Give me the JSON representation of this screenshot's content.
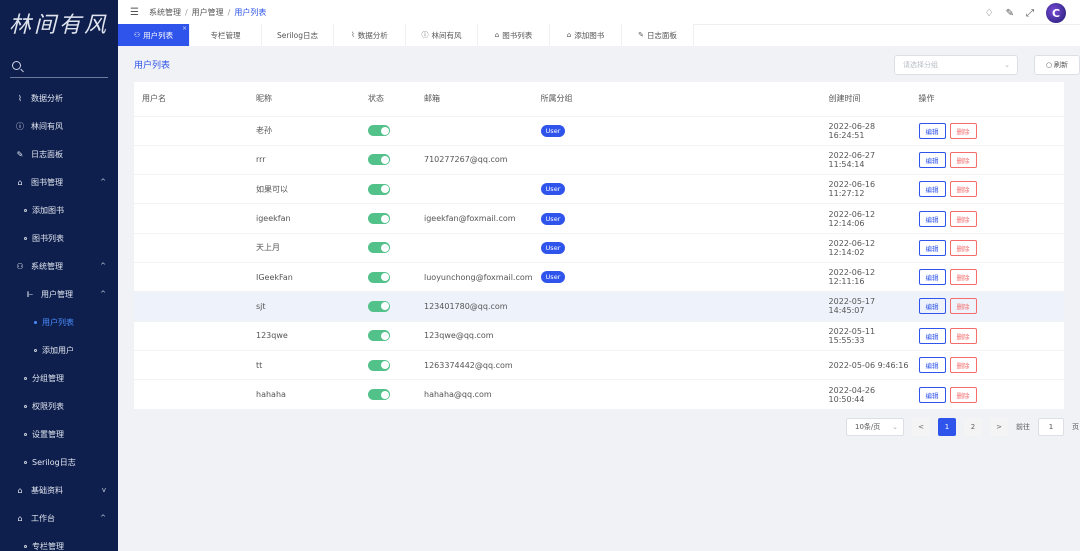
{
  "sidebar": {
    "logo": "林间有风",
    "items": [
      {
        "icon": "chart-icon",
        "glyph": "⌇",
        "label": "数据分析"
      },
      {
        "icon": "info-icon",
        "glyph": "ⓘ",
        "label": "林间有风"
      },
      {
        "icon": "edit-icon",
        "glyph": "✎",
        "label": "日志面板"
      },
      {
        "icon": "book-icon",
        "glyph": "⌂",
        "label": "图书管理",
        "arrow": "^"
      },
      {
        "label": "添加图书"
      },
      {
        "label": "图书列表"
      },
      {
        "icon": "users-icon",
        "glyph": "⚇",
        "label": "系统管理",
        "arrow": "^"
      },
      {
        "icon": "user-manage-icon",
        "glyph": "⊩",
        "label": "用户管理",
        "arrow": "^"
      },
      {
        "label": "用户列表"
      },
      {
        "label": "添加用户"
      },
      {
        "label": "分组管理"
      },
      {
        "label": "权限列表"
      },
      {
        "label": "设置管理"
      },
      {
        "label": "Serilog日志"
      },
      {
        "icon": "book-icon",
        "glyph": "⌂",
        "label": "基础资料",
        "arrow": "v"
      },
      {
        "icon": "book-icon",
        "glyph": "⌂",
        "label": "工作台",
        "arrow": "^"
      },
      {
        "label": "专栏管理"
      }
    ]
  },
  "topbar": {
    "menu_icon": "☰",
    "crumb1": "系统管理",
    "crumb2": "用户管理",
    "crumb3": "用户列表",
    "sep": "/",
    "bell": "♢",
    "magic": "✎",
    "fullscreen": "⤢",
    "avatar_letter": "C"
  },
  "tabs": [
    {
      "icon": "⚇",
      "label": "用户列表",
      "close": "×"
    },
    {
      "icon": "",
      "label": "专栏管理"
    },
    {
      "icon": "",
      "label": "Serilog日志"
    },
    {
      "icon": "⌇",
      "label": "数据分析"
    },
    {
      "icon": "ⓘ",
      "label": "林间有风"
    },
    {
      "icon": "⌂",
      "label": "图书列表"
    },
    {
      "icon": "⌂",
      "label": "添加图书"
    },
    {
      "icon": "✎",
      "label": "日志面板"
    }
  ],
  "panel": {
    "title": "用户列表",
    "group_placeholder": "请选择分组",
    "refresh_label": "刷新"
  },
  "table": {
    "headers": [
      "用户名",
      "昵称",
      "状态",
      "邮箱",
      "所属分组",
      "创建时间",
      "操作"
    ],
    "edit_label": "编辑",
    "delete_label": "删除",
    "rows": [
      {
        "username": "",
        "nickname": "老孙",
        "email": "",
        "group": "User",
        "created": "2022-06-28 16:24:51"
      },
      {
        "username": "",
        "nickname": "rrr",
        "email": "710277267@qq.com",
        "group": "",
        "created": "2022-06-27 11:54:14"
      },
      {
        "username": "",
        "nickname": "如果可以",
        "email": "",
        "group": "User",
        "created": "2022-06-16 11:27:12"
      },
      {
        "username": "",
        "nickname": "igeekfan",
        "email": "igeekfan@foxmail.com",
        "group": "User",
        "created": "2022-06-12 12:14:06"
      },
      {
        "username": "",
        "nickname": "天上月",
        "email": "",
        "group": "User",
        "created": "2022-06-12 12:14:02"
      },
      {
        "username": "",
        "nickname": "IGeekFan",
        "email": "luoyunchong@foxmail.com",
        "group": "User",
        "created": "2022-06-12 12:11:16"
      },
      {
        "username": "",
        "nickname": "sjt",
        "email": "123401780@qq.com",
        "group": "",
        "created": "2022-05-17 14:45:07"
      },
      {
        "username": "",
        "nickname": "123qwe",
        "email": "123qwe@qq.com",
        "group": "",
        "created": "2022-05-11 15:55:33"
      },
      {
        "username": "",
        "nickname": "tt",
        "email": "1263374442@qq.com",
        "group": "",
        "created": "2022-05-06 9:46:16"
      },
      {
        "username": "",
        "nickname": "hahaha",
        "email": "hahaha@qq.com",
        "group": "",
        "created": "2022-04-26 10:50:44"
      }
    ]
  },
  "pager": {
    "page_size": "10条/页",
    "prev": "<",
    "pages": [
      "1",
      "2"
    ],
    "next": ">",
    "goto_label": "前往",
    "goto_value": "1",
    "page_unit": "页"
  },
  "colors": {
    "accent": "#2f54eb",
    "sidebar": "#0f1f4d",
    "toggle_on": "#52c18a",
    "danger": "#f56c6c"
  }
}
